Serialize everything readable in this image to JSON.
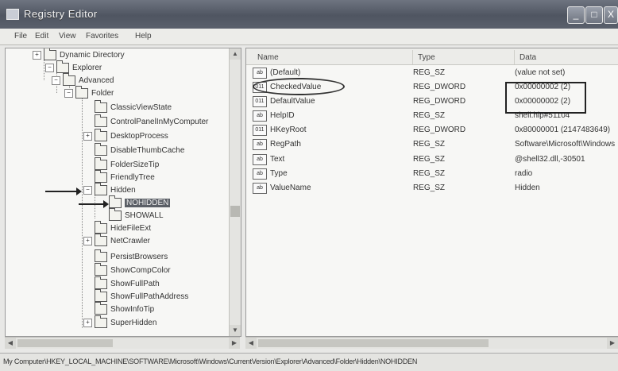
{
  "window": {
    "title": "Registry Editor",
    "minimize_glyph": "_",
    "maximize_glyph": "□",
    "close_glyph": "X"
  },
  "menu": [
    "File",
    "Edit",
    "View",
    "Favorites",
    "Help"
  ],
  "tree": [
    {
      "label": "Dynamic Directory",
      "expander": "+"
    },
    {
      "label": "Explorer",
      "expander": "−"
    },
    {
      "label": "Advanced",
      "expander": "−"
    },
    {
      "label": "Folder",
      "expander": "−"
    },
    {
      "label": "ClassicViewState",
      "expander": ""
    },
    {
      "label": "ControlPanelInMyComputer",
      "expander": ""
    },
    {
      "label": "DesktopProcess",
      "expander": "+"
    },
    {
      "label": "DisableThumbCache",
      "expander": ""
    },
    {
      "label": "FolderSizeTip",
      "expander": ""
    },
    {
      "label": "FriendlyTree",
      "expander": ""
    },
    {
      "label": "Hidden",
      "expander": "−"
    },
    {
      "label": "NOHIDDEN",
      "expander": ""
    },
    {
      "label": "SHOWALL",
      "expander": ""
    },
    {
      "label": "HideFileExt",
      "expander": ""
    },
    {
      "label": "NetCrawler",
      "expander": "+"
    },
    {
      "label": "PersistBrowsers",
      "expander": ""
    },
    {
      "label": "ShowCompColor",
      "expander": ""
    },
    {
      "label": "ShowFullPath",
      "expander": ""
    },
    {
      "label": "ShowFullPathAddress",
      "expander": ""
    },
    {
      "label": "ShowInfoTip",
      "expander": ""
    },
    {
      "label": "SuperHidden",
      "expander": "+"
    }
  ],
  "columns": {
    "name": "Name",
    "type": "Type",
    "data": "Data"
  },
  "values": [
    {
      "icon": "ab",
      "name": "(Default)",
      "type": "REG_SZ",
      "data": "(value not set)"
    },
    {
      "icon": "011",
      "name": "CheckedValue",
      "type": "REG_DWORD",
      "data": "0x00000002 (2)"
    },
    {
      "icon": "011",
      "name": "DefaultValue",
      "type": "REG_DWORD",
      "data": "0x00000002 (2)"
    },
    {
      "icon": "ab",
      "name": "HelpID",
      "type": "REG_SZ",
      "data": "shell.hlp#51104"
    },
    {
      "icon": "011",
      "name": "HKeyRoot",
      "type": "REG_DWORD",
      "data": "0x80000001 (2147483649)"
    },
    {
      "icon": "ab",
      "name": "RegPath",
      "type": "REG_SZ",
      "data": "Software\\Microsoft\\Windows"
    },
    {
      "icon": "ab",
      "name": "Text",
      "type": "REG_SZ",
      "data": "@shell32.dll,-30501"
    },
    {
      "icon": "ab",
      "name": "Type",
      "type": "REG_SZ",
      "data": "radio"
    },
    {
      "icon": "ab",
      "name": "ValueName",
      "type": "REG_SZ",
      "data": "Hidden"
    }
  ],
  "scroll_glyphs": {
    "up": "▲",
    "down": "▼",
    "left": "◀",
    "right": "▶"
  },
  "status": "My Computer\\HKEY_LOCAL_MACHINE\\SOFTWARE\\Microsoft\\Windows\\CurrentVersion\\Explorer\\Advanced\\Folder\\Hidden\\NOHIDDEN"
}
